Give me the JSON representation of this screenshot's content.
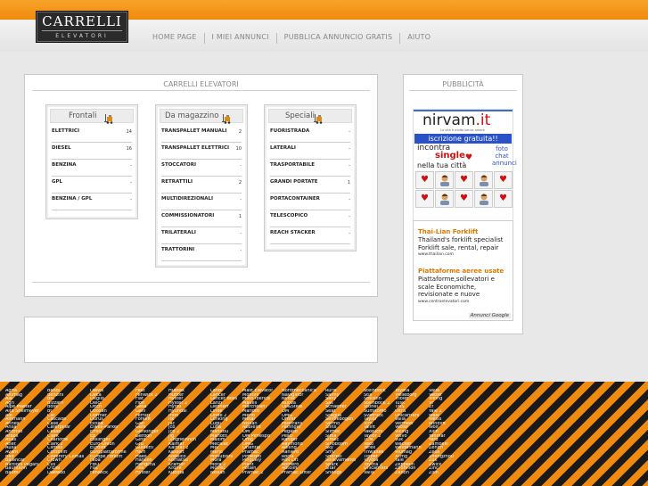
{
  "brand": {
    "name": "CARRELLI",
    "sub": "ELEVATORI"
  },
  "nav": [
    "HOME PAGE",
    "I MIEI ANNUNCI",
    "PUBBLICA ANNUNCIO GRATIS",
    "AIUTO"
  ],
  "main_title": "CARRELLI ELEVATORI",
  "ads_title": "PUBBLICITÀ",
  "categories": [
    {
      "title": "Frontali",
      "items": [
        [
          "ELETTRICI",
          "14"
        ],
        [
          "DIESEL",
          "16"
        ],
        [
          "BENZINA",
          "-"
        ],
        [
          "GPL",
          "-"
        ],
        [
          "BENZINA / GPL",
          "-"
        ]
      ]
    },
    {
      "title": "Da magazzino",
      "items": [
        [
          "TRANSPALLET MANUALI",
          "2"
        ],
        [
          "TRANSPALLET ELETTRICI",
          "10"
        ],
        [
          "STOCCATORI",
          "-"
        ],
        [
          "RETRATTILI",
          "2"
        ],
        [
          "MULTIDIREZIONALI",
          "-"
        ],
        [
          "COMMISSIONATORI",
          "1"
        ],
        [
          "TRILATERALI",
          "-"
        ],
        [
          "TRATTORINI",
          "-"
        ]
      ]
    },
    {
      "title": "Speciali",
      "items": [
        [
          "FUORISTRADA",
          "-"
        ],
        [
          "LATERALI",
          "-"
        ],
        [
          "TRASPORTABILE",
          "-"
        ],
        [
          "GRANDI PORTATE",
          "1"
        ],
        [
          "PORTACONTAINER",
          "-"
        ],
        [
          "TELESCOPICO",
          "-"
        ],
        [
          "REACH STACKER",
          "-"
        ]
      ]
    }
  ],
  "banner": {
    "site": "nirvam",
    "tld": ".it",
    "tagline": "La vita è molto senza amore",
    "cta": "iscrizione gratuita!!",
    "line1": "incontra",
    "line2": "single",
    "line3": "nella tua città",
    "side": [
      "foto",
      "chat",
      "annunci"
    ]
  },
  "google_ads": [
    {
      "title": "Thai-Lian Forklift",
      "body": "Thailand's forklift specialist Forklift sale, rental, repair",
      "url": "www.thailian.com"
    },
    {
      "title": "Piattaforme aeree usate",
      "body": "Piattaforme,sollevatori e scale Economiche, revisionate e nuove",
      "url": "www.centroelevatori.com"
    }
  ],
  "google_label": "Annunci Google",
  "footer_cols": [
    [
      "Agria",
      "Ahlmag",
      "Aia",
      "Agri",
      "Alpe Master",
      "Alfa Shelmeyer",
      "Alo",
      "Ammann",
      "Annex",
      "Ansa",
      "Antonio",
      "Arbos",
      "Atlas",
      "Atlet",
      "Ausa",
      "Avant",
      "Bad",
      "Balancar",
      "Battioni Pagani",
      "Baumann",
      "Baumi"
    ],
    [
      "Bendi",
      "Benzini",
      "Biu",
      "Bizzarri",
      "Boss",
      "Bt",
      "Cat",
      "Cascade",
      "Case",
      "Caterpillar",
      "Cesab",
      "Clark",
      "Charlotte",
      "Clark 2",
      "Climax",
      "Combilift",
      "Coventry Climax",
      "Crown",
      "Cvs",
      "D'Elia",
      "Daewoo"
    ],
    [
      "Dalvis",
      "Deca",
      "Deglio",
      "Dieci",
      "Ditch",
      "Doosan",
      "Dormer",
      "Durus",
      "Eksea",
      "Elwell-Parker",
      "Emily",
      "Ep",
      "Esslinger",
      "Euro-Union",
      "Eurolift",
      "Europiattaforme",
      "Europe Forklift",
      "Faba",
      "FBO",
      "Fiat",
      "Fenwick"
    ],
    [
      "Feat",
      "Fenwick 2",
      "Fiat",
      "Fiori",
      "Gesa",
      "Galli",
      "Ferrari",
      "Forklift",
      "Gali",
      "Gehl",
      "Genkinger",
      "Gerdon",
      "Gino",
      "Gru",
      "Guidetti",
      "H&H",
      "Hako",
      "Hansen",
      "Hangcha",
      "Heli",
      "Hyster"
    ],
    [
      "Hubtex",
      "Hunter",
      "Hyster",
      "Hyster 2",
      "Hytsu",
      "Hyundai",
      "Irion",
      "Itk",
      "Jac",
      "Jcb",
      "Jcb 2",
      "Jlg",
      "Jungheinrich",
      "Kalmar",
      "Kalmar 2",
      "Kesslift",
      "Kobelco",
      "Komatsu",
      "Kramer",
      "Krone",
      "Kubota"
    ],
    [
      "Landi",
      "Lancer",
      "Lancer Boss",
      "Lanzl",
      "Liebherr",
      "Linde",
      "Linde 2",
      "Lonking",
      "Lugli",
      "Luna",
      "Manitou",
      "Mariotti",
      "Maxim",
      "Mecalac",
      "Mei",
      "Merlo",
      "Mitsubishi",
      "Mora",
      "Mora 2",
      "Motrec",
      "Nissan"
    ],
    [
      "Mast Elevator",
      "Montini",
      "Moto Iberica",
      "Mauell",
      "Marchesini",
      "Mariotti",
      "Merlo",
      "Metal",
      "Nissan",
      "Noblelift",
      "OM",
      "OM Pimespo",
      "Omg",
      "OMG",
      "Oriental",
      "Pramac",
      "Pimespo",
      "Pinguely",
      "Plant",
      "Potain",
      "Pramac 2"
    ],
    [
      "Nordmeccanica",
      "Navigator",
      "Nilfisk",
      "Nuova",
      "Oil&Steel",
      "OM",
      "OMG",
      "Omfer",
      "Paletrans",
      "Palfinger",
      "Pegaso",
      "Pesci",
      "Ranger",
      "Raymond",
      "Rolling",
      "Raniero",
      "Rocla",
      "Roll Lift",
      "Romero",
      "Rotolift",
      "Pramac Lifter"
    ],
    [
      "Ruris",
      "Sanny",
      "Sany",
      "Sas",
      "Schaeffer",
      "Seat",
      "Scaglia",
      "Sennebogen",
      "Sermo",
      "Sfinx",
      "Silmec",
      "Sima",
      "Simec",
      "Sinoboom",
      "Sky",
      "Smv",
      "Snorkel",
      "Sollevamento",
      "Spark",
      "Sitar",
      "Shengli"
    ],
    [
      "Steinbock",
      "Still",
      "Stocklin",
      "Steinbock 2",
      "Stonel",
      "Sumitomo",
      "Svetruck",
      "Taylor",
      "Tcm",
      "Tailift",
      "Takeuchi",
      "Taylor 2",
      "TCM",
      "Teko",
      "Terex",
      "Thwaites",
      "Tipper",
      "Toyota",
      "Toyota 2",
      "Unicarriers",
      "Valla"
    ],
    [
      "Toyota",
      "Trelleborg",
      "Triolet",
      "Tusk",
      "TMS",
      "Ultra",
      "Unicarriers",
      "Valla",
      "Vermeer",
      "Vetter",
      "Viking",
      "Volvo",
      "Vuk",
      "Wacker",
      "Weidemann",
      "Wumag",
      "Xcmg",
      "Yale",
      "Zeppelin",
      "Zoomlion",
      "Zanon"
    ],
    [
      "Valla",
      "Vetter",
      "Viking",
      "Vr",
      "Zf",
      "Yale 2",
      "Walk",
      "Weiss",
      "Windlift",
      "Wolf",
      "Xilin",
      "Yanmar",
      "Yard",
      "Zambelli",
      "Zenith",
      "Zeus",
      "Zhengzhou",
      "Zuk",
      "Zwick",
      "Zinc",
      "Zilin"
    ]
  ]
}
